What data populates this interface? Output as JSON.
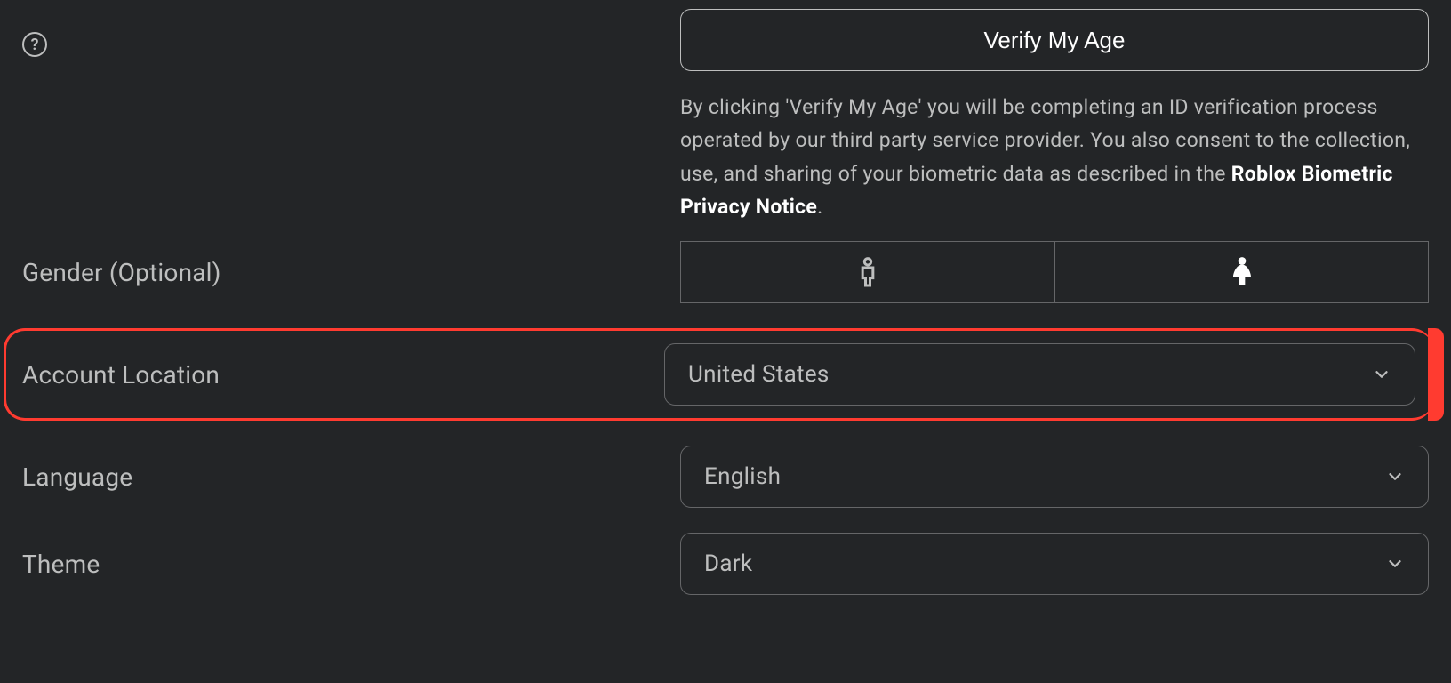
{
  "verify": {
    "button_label": "Verify My Age",
    "disclaimer_prefix": "By clicking 'Verify My Age' you will be completing an ID verification process operated by our third party service provider. You also consent to the collection, use, and sharing of your biometric data as described in the ",
    "disclaimer_link": "Roblox Biometric Privacy Notice",
    "disclaimer_suffix": "."
  },
  "gender": {
    "label": "Gender (Optional)",
    "options": {
      "male": "male-icon",
      "female": "female-icon"
    },
    "selected": "female"
  },
  "location": {
    "label": "Account Location",
    "value": "United States"
  },
  "language": {
    "label": "Language",
    "value": "English"
  },
  "theme": {
    "label": "Theme",
    "value": "Dark"
  }
}
